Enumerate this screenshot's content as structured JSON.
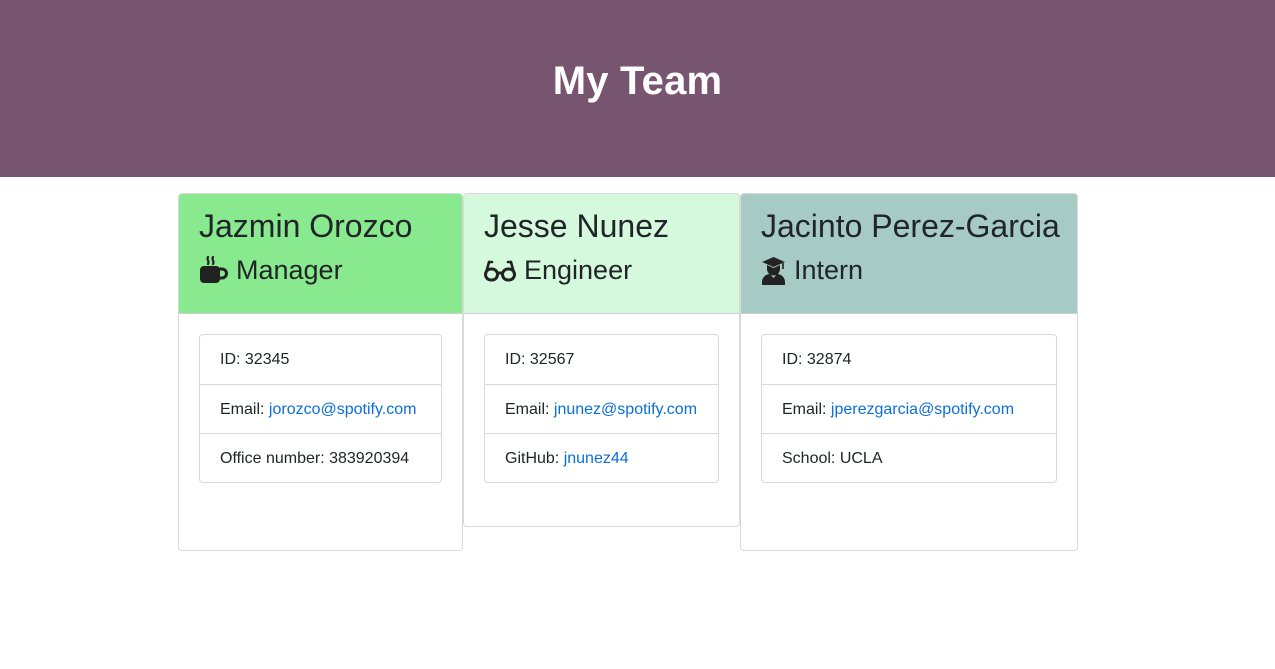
{
  "header": {
    "title": "My Team"
  },
  "colors": {
    "banner": "#77546f",
    "manager": "#88e98e",
    "engineer": "#d5f9dc",
    "intern": "#a6cbc4",
    "link": "#0b6fd8"
  },
  "cards": [
    {
      "name": "Jazmin Orozco",
      "role": "Manager",
      "icon": "mug-icon",
      "id_text": "ID: 32345",
      "email_label": "Email: ",
      "email": "jorozco@spotify.com",
      "extra_label": "Office number: 383920394",
      "extra_link": ""
    },
    {
      "name": "Jesse Nunez",
      "role": "Engineer",
      "icon": "glasses-icon",
      "id_text": "ID: 32567",
      "email_label": "Email: ",
      "email": "jnunez@spotify.com",
      "extra_label": "GitHub: ",
      "extra_link": "jnunez44"
    },
    {
      "name": "Jacinto Perez-Garcia",
      "role": "Intern",
      "icon": "graduate-icon",
      "id_text": "ID: 32874",
      "email_label": "Email: ",
      "email": "jperezgarcia@spotify.com",
      "extra_label": "School: UCLA",
      "extra_link": ""
    }
  ]
}
